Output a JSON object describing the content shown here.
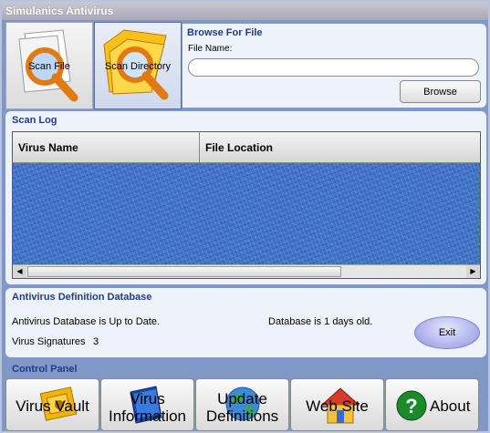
{
  "window": {
    "title": "Simulanics Antivirus"
  },
  "scan_buttons": {
    "scan_file": "Scan File",
    "scan_directory": "Scan Directory"
  },
  "browse": {
    "section_title": "Browse For File",
    "file_name_label": "File Name:",
    "file_name_value": "",
    "browse_label": "Browse"
  },
  "scan_log": {
    "section_title": "Scan Log",
    "columns": [
      "Virus Name",
      "File Location"
    ],
    "rows": []
  },
  "database": {
    "section_title": "Antivirus Definition Database",
    "status": "Antivirus Database is Up to Date.",
    "age": "Database is 1 days old.",
    "signatures_label": "Virus Signatures",
    "signatures_count": "3",
    "exit_label": "Exit"
  },
  "control_panel": {
    "section_title": "Control Panel",
    "buttons": [
      {
        "label": "Virus Vault",
        "icon": "vault-icon"
      },
      {
        "label": "Virus\nInformation",
        "icon": "book-icon"
      },
      {
        "label": "Update\nDefinitions",
        "icon": "globe-icon"
      },
      {
        "label": "Web Site",
        "icon": "house-icon"
      },
      {
        "label": "About",
        "icon": "question-icon"
      }
    ]
  },
  "colors": {
    "accent": "#1f3d8a",
    "frame": "#7f98c8",
    "panel": "#eef2fa",
    "list_background": "#3f72c8"
  }
}
